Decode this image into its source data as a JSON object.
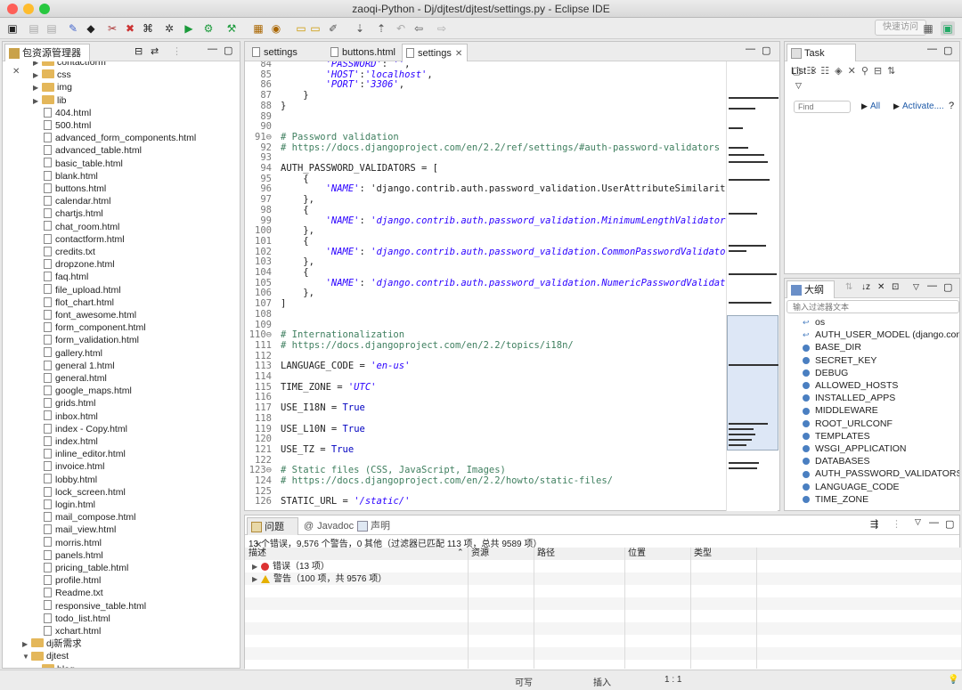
{
  "window": {
    "title": "zaoqi-Python - Dj/djtest/djtest/settings.py - Eclipse IDE",
    "quick_access": "快速访问"
  },
  "left_pane": {
    "title": "包资源管理器",
    "items": [
      {
        "label": "contactform",
        "type": "folder",
        "indent": 1,
        "expanded": false
      },
      {
        "label": "css",
        "type": "folder",
        "indent": 1,
        "expanded": false
      },
      {
        "label": "img",
        "type": "folder",
        "indent": 1,
        "expanded": false
      },
      {
        "label": "lib",
        "type": "folder",
        "indent": 1,
        "expanded": false
      },
      {
        "label": "404.html",
        "type": "file",
        "indent": 2
      },
      {
        "label": "500.html",
        "type": "file",
        "indent": 2
      },
      {
        "label": "advanced_form_components.html",
        "type": "file",
        "indent": 2
      },
      {
        "label": "advanced_table.html",
        "type": "file",
        "indent": 2
      },
      {
        "label": "basic_table.html",
        "type": "file",
        "indent": 2
      },
      {
        "label": "blank.html",
        "type": "file",
        "indent": 2
      },
      {
        "label": "buttons.html",
        "type": "file",
        "indent": 2
      },
      {
        "label": "calendar.html",
        "type": "file",
        "indent": 2
      },
      {
        "label": "chartjs.html",
        "type": "file",
        "indent": 2
      },
      {
        "label": "chat_room.html",
        "type": "file",
        "indent": 2
      },
      {
        "label": "contactform.html",
        "type": "file",
        "indent": 2
      },
      {
        "label": "credits.txt",
        "type": "file",
        "indent": 2
      },
      {
        "label": "dropzone.html",
        "type": "file",
        "indent": 2
      },
      {
        "label": "faq.html",
        "type": "file",
        "indent": 2
      },
      {
        "label": "file_upload.html",
        "type": "file",
        "indent": 2
      },
      {
        "label": "flot_chart.html",
        "type": "file",
        "indent": 2
      },
      {
        "label": "font_awesome.html",
        "type": "file",
        "indent": 2
      },
      {
        "label": "form_component.html",
        "type": "file",
        "indent": 2
      },
      {
        "label": "form_validation.html",
        "type": "file",
        "indent": 2
      },
      {
        "label": "gallery.html",
        "type": "file",
        "indent": 2
      },
      {
        "label": "general 1.html",
        "type": "file",
        "indent": 2
      },
      {
        "label": "general.html",
        "type": "file",
        "indent": 2
      },
      {
        "label": "google_maps.html",
        "type": "file",
        "indent": 2
      },
      {
        "label": "grids.html",
        "type": "file",
        "indent": 2
      },
      {
        "label": "inbox.html",
        "type": "file",
        "indent": 2
      },
      {
        "label": "index - Copy.html",
        "type": "file",
        "indent": 2
      },
      {
        "label": "index.html",
        "type": "file",
        "indent": 2
      },
      {
        "label": "inline_editor.html",
        "type": "file",
        "indent": 2
      },
      {
        "label": "invoice.html",
        "type": "file",
        "indent": 2
      },
      {
        "label": "lobby.html",
        "type": "file",
        "indent": 2
      },
      {
        "label": "lock_screen.html",
        "type": "file",
        "indent": 2
      },
      {
        "label": "login.html",
        "type": "file",
        "indent": 2
      },
      {
        "label": "mail_compose.html",
        "type": "file",
        "indent": 2
      },
      {
        "label": "mail_view.html",
        "type": "file",
        "indent": 2
      },
      {
        "label": "morris.html",
        "type": "file",
        "indent": 2
      },
      {
        "label": "panels.html",
        "type": "file",
        "indent": 2
      },
      {
        "label": "pricing_table.html",
        "type": "file",
        "indent": 2
      },
      {
        "label": "profile.html",
        "type": "file",
        "indent": 2
      },
      {
        "label": "Readme.txt",
        "type": "file",
        "indent": 2
      },
      {
        "label": "responsive_table.html",
        "type": "file",
        "indent": 2
      },
      {
        "label": "todo_list.html",
        "type": "file",
        "indent": 2
      },
      {
        "label": "xchart.html",
        "type": "file",
        "indent": 2
      },
      {
        "label": "dj新需求",
        "type": "folder",
        "indent": 0,
        "expanded": false
      },
      {
        "label": "djtest",
        "type": "folder",
        "indent": 0,
        "expanded": true
      },
      {
        "label": "blog",
        "type": "folder",
        "indent": 1,
        "expanded": true
      }
    ]
  },
  "editor": {
    "tabs": [
      {
        "label": "settings",
        "active": false
      },
      {
        "label": "buttons.html",
        "active": false
      },
      {
        "label": "settings",
        "active": true
      }
    ],
    "lines": [
      {
        "n": "84",
        "t": "        'PASSWORD': '',"
      },
      {
        "n": "85",
        "t": "        'HOST':'localhost',"
      },
      {
        "n": "86",
        "t": "        'PORT':'3306',"
      },
      {
        "n": "87",
        "t": "    }"
      },
      {
        "n": "88",
        "t": "}"
      },
      {
        "n": "89",
        "t": ""
      },
      {
        "n": "90",
        "t": ""
      },
      {
        "n": "91⊖",
        "t": "# Password validation"
      },
      {
        "n": "92",
        "t": "# https://docs.djangoproject.com/en/2.2/ref/settings/#auth-password-validators"
      },
      {
        "n": "93",
        "t": ""
      },
      {
        "n": "94",
        "t": "AUTH_PASSWORD_VALIDATORS = ["
      },
      {
        "n": "95",
        "t": "    {"
      },
      {
        "n": "96",
        "t": "        'NAME': 'django.contrib.auth.password_validation.UserAttributeSimilarityVal"
      },
      {
        "n": "97",
        "t": "    },"
      },
      {
        "n": "98",
        "t": "    {"
      },
      {
        "n": "99",
        "t": "        'NAME': 'django.contrib.auth.password_validation.MinimumLengthValidator',"
      },
      {
        "n": "100",
        "t": "    },"
      },
      {
        "n": "101",
        "t": "    {"
      },
      {
        "n": "102",
        "t": "        'NAME': 'django.contrib.auth.password_validation.CommonPasswordValidator',"
      },
      {
        "n": "103",
        "t": "    },"
      },
      {
        "n": "104",
        "t": "    {"
      },
      {
        "n": "105",
        "t": "        'NAME': 'django.contrib.auth.password_validation.NumericPasswordValidator',"
      },
      {
        "n": "106",
        "t": "    },"
      },
      {
        "n": "107",
        "t": "]"
      },
      {
        "n": "108",
        "t": ""
      },
      {
        "n": "109",
        "t": ""
      },
      {
        "n": "110⊖",
        "t": "# Internationalization"
      },
      {
        "n": "111",
        "t": "# https://docs.djangoproject.com/en/2.2/topics/i18n/"
      },
      {
        "n": "112",
        "t": ""
      },
      {
        "n": "113",
        "t": "LANGUAGE_CODE = 'en-us'"
      },
      {
        "n": "114",
        "t": ""
      },
      {
        "n": "115",
        "t": "TIME_ZONE = 'UTC'"
      },
      {
        "n": "116",
        "t": ""
      },
      {
        "n": "117",
        "t": "USE_I18N = True"
      },
      {
        "n": "118",
        "t": ""
      },
      {
        "n": "119",
        "t": "USE_L10N = True"
      },
      {
        "n": "120",
        "t": ""
      },
      {
        "n": "121",
        "t": "USE_TZ = True"
      },
      {
        "n": "122",
        "t": ""
      },
      {
        "n": "123⊖",
        "t": "# Static files (CSS, JavaScript, Images)"
      },
      {
        "n": "124",
        "t": "# https://docs.djangoproject.com/en/2.2/howto/static-files/"
      },
      {
        "n": "125",
        "t": ""
      },
      {
        "n": "126",
        "t": "STATIC_URL = '/static/'"
      }
    ]
  },
  "tasklist": {
    "title": "Task List",
    "find_placeholder": "Find",
    "all_label": "All",
    "activate_label": "Activate...."
  },
  "outline": {
    "title": "大纲",
    "filter_placeholder": "输入过滤器文本",
    "items": [
      {
        "label": "os",
        "kind": "import"
      },
      {
        "label": "AUTH_USER_MODEL (django.conf.glol",
        "kind": "import"
      },
      {
        "label": "BASE_DIR",
        "kind": "var"
      },
      {
        "label": "SECRET_KEY",
        "kind": "var"
      },
      {
        "label": "DEBUG",
        "kind": "var"
      },
      {
        "label": "ALLOWED_HOSTS",
        "kind": "var"
      },
      {
        "label": "INSTALLED_APPS",
        "kind": "var"
      },
      {
        "label": "MIDDLEWARE",
        "kind": "var"
      },
      {
        "label": "ROOT_URLCONF",
        "kind": "var"
      },
      {
        "label": "TEMPLATES",
        "kind": "var"
      },
      {
        "label": "WSGI_APPLICATION",
        "kind": "var"
      },
      {
        "label": "DATABASES",
        "kind": "var"
      },
      {
        "label": "AUTH_PASSWORD_VALIDATORS",
        "kind": "var"
      },
      {
        "label": "LANGUAGE_CODE",
        "kind": "var"
      },
      {
        "label": "TIME_ZONE",
        "kind": "var"
      }
    ]
  },
  "problems": {
    "tabs": [
      "问题",
      "Javadoc",
      "声明"
    ],
    "summary": "13 个错误，9,576 个警告，0 其他（过滤器已匹配 113 项，总共 9589 项）",
    "columns": [
      "描述",
      "资源",
      "路径",
      "位置",
      "类型"
    ],
    "errors_label": "错误（13 项）",
    "warnings_label": "警告（100 项，共 9576 项）"
  },
  "status": {
    "writable": "可写",
    "insert": "插入",
    "position": "1 : 1"
  }
}
